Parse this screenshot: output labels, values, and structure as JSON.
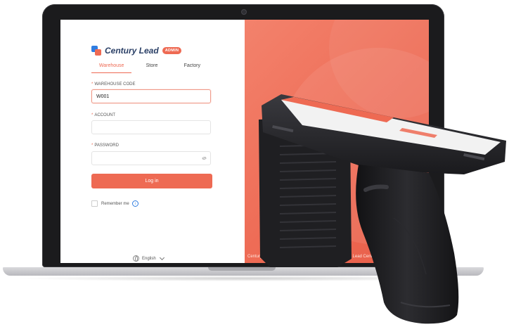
{
  "login": {
    "brand_name": "Century Lead",
    "badge": "ADMIN",
    "tabs": [
      {
        "label": "Warehouse",
        "active": true
      },
      {
        "label": "Store",
        "active": false
      },
      {
        "label": "Factory",
        "active": false
      }
    ],
    "warehouse_code": {
      "label": "WAREHOUSE CODE",
      "value": "W001"
    },
    "account": {
      "label": "ACCOUNT",
      "value": ""
    },
    "password": {
      "label": "PASSWORD",
      "value": ""
    },
    "required_mark": "*",
    "login_button": "Log in",
    "remember_me": "Remember me",
    "info_glyph": "i",
    "language": "English"
  },
  "footer": {
    "copyright": "Century Lead Version:101.21c6872 © 2025 Guangzhou Lead Century"
  },
  "colors": {
    "accent": "#ee6a53",
    "brand_blue": "#2f7de1",
    "device_body": "#1e1e20"
  },
  "icons": [
    "eye-icon",
    "info-icon",
    "globe-icon",
    "chevron-down-icon",
    "logo-icon"
  ]
}
